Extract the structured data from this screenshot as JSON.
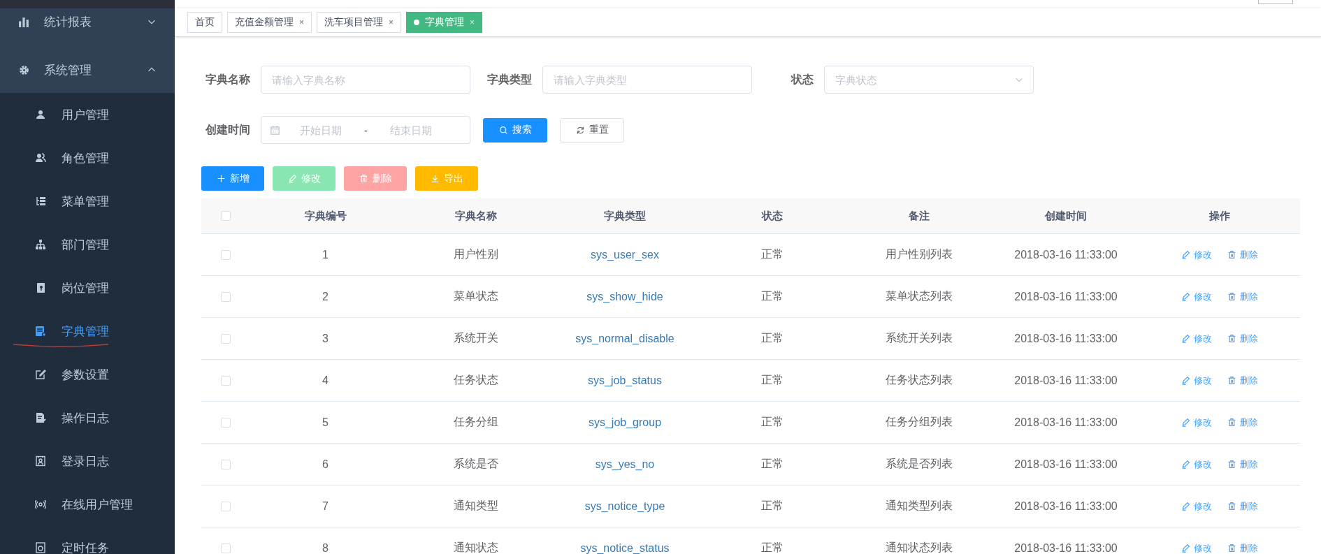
{
  "sidebar": {
    "items": [
      {
        "label": "统计报表",
        "expanded": false
      },
      {
        "label": "系统管理",
        "expanded": true,
        "children": [
          {
            "label": "用户管理",
            "selected": false
          },
          {
            "label": "角色管理",
            "selected": false
          },
          {
            "label": "菜单管理",
            "selected": false
          },
          {
            "label": "部门管理",
            "selected": false
          },
          {
            "label": "岗位管理",
            "selected": false
          },
          {
            "label": "字典管理",
            "selected": true
          },
          {
            "label": "参数设置",
            "selected": false
          },
          {
            "label": "操作日志",
            "selected": false
          },
          {
            "label": "登录日志",
            "selected": false
          },
          {
            "label": "在线用户管理",
            "selected": false
          },
          {
            "label": "定时任务",
            "selected": false
          }
        ]
      }
    ]
  },
  "tabs": [
    {
      "label": "首页",
      "selected": false
    },
    {
      "label": "充值金额管理",
      "close": "×",
      "selected": false
    },
    {
      "label": "洗车项目管理",
      "close": "×",
      "selected": false
    },
    {
      "label": "字典管理",
      "close": "×",
      "selected": true
    }
  ],
  "filters": {
    "fields": [
      {
        "kind": "input",
        "label": "字典名称",
        "placeholder": "请输入字典名称"
      },
      {
        "kind": "input",
        "label": "字典类型",
        "placeholder": "请输入字典类型"
      },
      {
        "kind": "select",
        "label": "状态",
        "placeholder": "字典状态"
      }
    ],
    "date_range": {
      "label": "创建时间",
      "start_placeholder": "开始日期",
      "separator": "-",
      "end_placeholder": "结束日期"
    },
    "buttons": [
      {
        "kind": "search",
        "label": "搜索"
      },
      {
        "kind": "reset",
        "label": "重置"
      }
    ]
  },
  "toolbar": [
    {
      "kind": "add",
      "label": "新增",
      "disabled": false
    },
    {
      "kind": "edit",
      "label": "修改",
      "disabled": true
    },
    {
      "kind": "delete",
      "label": "删除",
      "disabled": true
    },
    {
      "kind": "export",
      "label": "导出",
      "disabled": false
    }
  ],
  "table": {
    "all_checked": false,
    "columns": [
      "字典编号",
      "字典名称",
      "字典类型",
      "状态",
      "备注",
      "创建时间",
      "操作"
    ],
    "rows": [
      {
        "checked": false,
        "cells": [
          "1",
          "用户性别",
          "sys_user_sex",
          "正常",
          "用户性别列表",
          "2018-03-16 11:33:00"
        ],
        "actions": [
          "修改",
          "删除"
        ]
      },
      {
        "checked": false,
        "cells": [
          "2",
          "菜单状态",
          "sys_show_hide",
          "正常",
          "菜单状态列表",
          "2018-03-16 11:33:00"
        ],
        "actions": [
          "修改",
          "删除"
        ]
      },
      {
        "checked": false,
        "cells": [
          "3",
          "系统开关",
          "sys_normal_disable",
          "正常",
          "系统开关列表",
          "2018-03-16 11:33:00"
        ],
        "actions": [
          "修改",
          "删除"
        ]
      },
      {
        "checked": false,
        "cells": [
          "4",
          "任务状态",
          "sys_job_status",
          "正常",
          "任务状态列表",
          "2018-03-16 11:33:00"
        ],
        "actions": [
          "修改",
          "删除"
        ]
      },
      {
        "checked": false,
        "cells": [
          "5",
          "任务分组",
          "sys_job_group",
          "正常",
          "任务分组列表",
          "2018-03-16 11:33:00"
        ],
        "actions": [
          "修改",
          "删除"
        ]
      },
      {
        "checked": false,
        "cells": [
          "6",
          "系统是否",
          "sys_yes_no",
          "正常",
          "系统是否列表",
          "2018-03-16 11:33:00"
        ],
        "actions": [
          "修改",
          "删除"
        ]
      },
      {
        "checked": false,
        "cells": [
          "7",
          "通知类型",
          "sys_notice_type",
          "正常",
          "通知类型列表",
          "2018-03-16 11:33:00"
        ],
        "actions": [
          "修改",
          "删除"
        ]
      },
      {
        "checked": false,
        "cells": [
          "8",
          "通知状态",
          "sys_notice_status",
          "正常",
          "通知状态列表",
          "2018-03-16 11:33:00"
        ],
        "actions": [
          "修改",
          "删除"
        ]
      }
    ]
  }
}
